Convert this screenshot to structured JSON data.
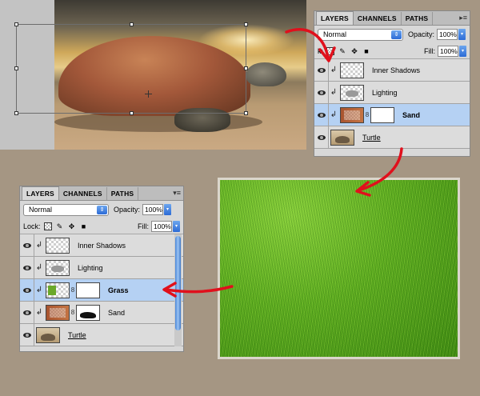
{
  "panel_top": {
    "tabs": [
      "LAYERS",
      "CHANNELS",
      "PATHS"
    ],
    "blend_mode": "Normal",
    "opacity_label": "Opacity:",
    "opacity_value": "100%",
    "lock_label": "k:",
    "fill_label": "Fill:",
    "fill_value": "100%",
    "layers": [
      {
        "name": "Inner Shadows"
      },
      {
        "name": "Lighting"
      },
      {
        "name": "Sand"
      },
      {
        "name": "Turtle"
      }
    ]
  },
  "panel_bottom": {
    "tabs": [
      "LAYERS",
      "CHANNELS",
      "PATHS"
    ],
    "blend_mode": "Normal",
    "opacity_label": "Opacity:",
    "opacity_value": "100%",
    "lock_label": "Lock:",
    "fill_label": "Fill:",
    "fill_value": "100%",
    "layers": [
      {
        "name": "Inner Shadows"
      },
      {
        "name": "Lighting"
      },
      {
        "name": "Grass"
      },
      {
        "name": "Sand"
      },
      {
        "name": "Turtle"
      }
    ]
  },
  "colors": {
    "background": "#a59683",
    "selected_layer": "#b5d1f3",
    "arrow": "#e0101c"
  },
  "icons": [
    "eye-icon",
    "clipping-arrow-icon",
    "link-chain-icon",
    "lock-transparent-icon",
    "brush-icon",
    "move-icon",
    "lock-icon",
    "panel-menu-icon",
    "dropdown-arrow-icon"
  ]
}
